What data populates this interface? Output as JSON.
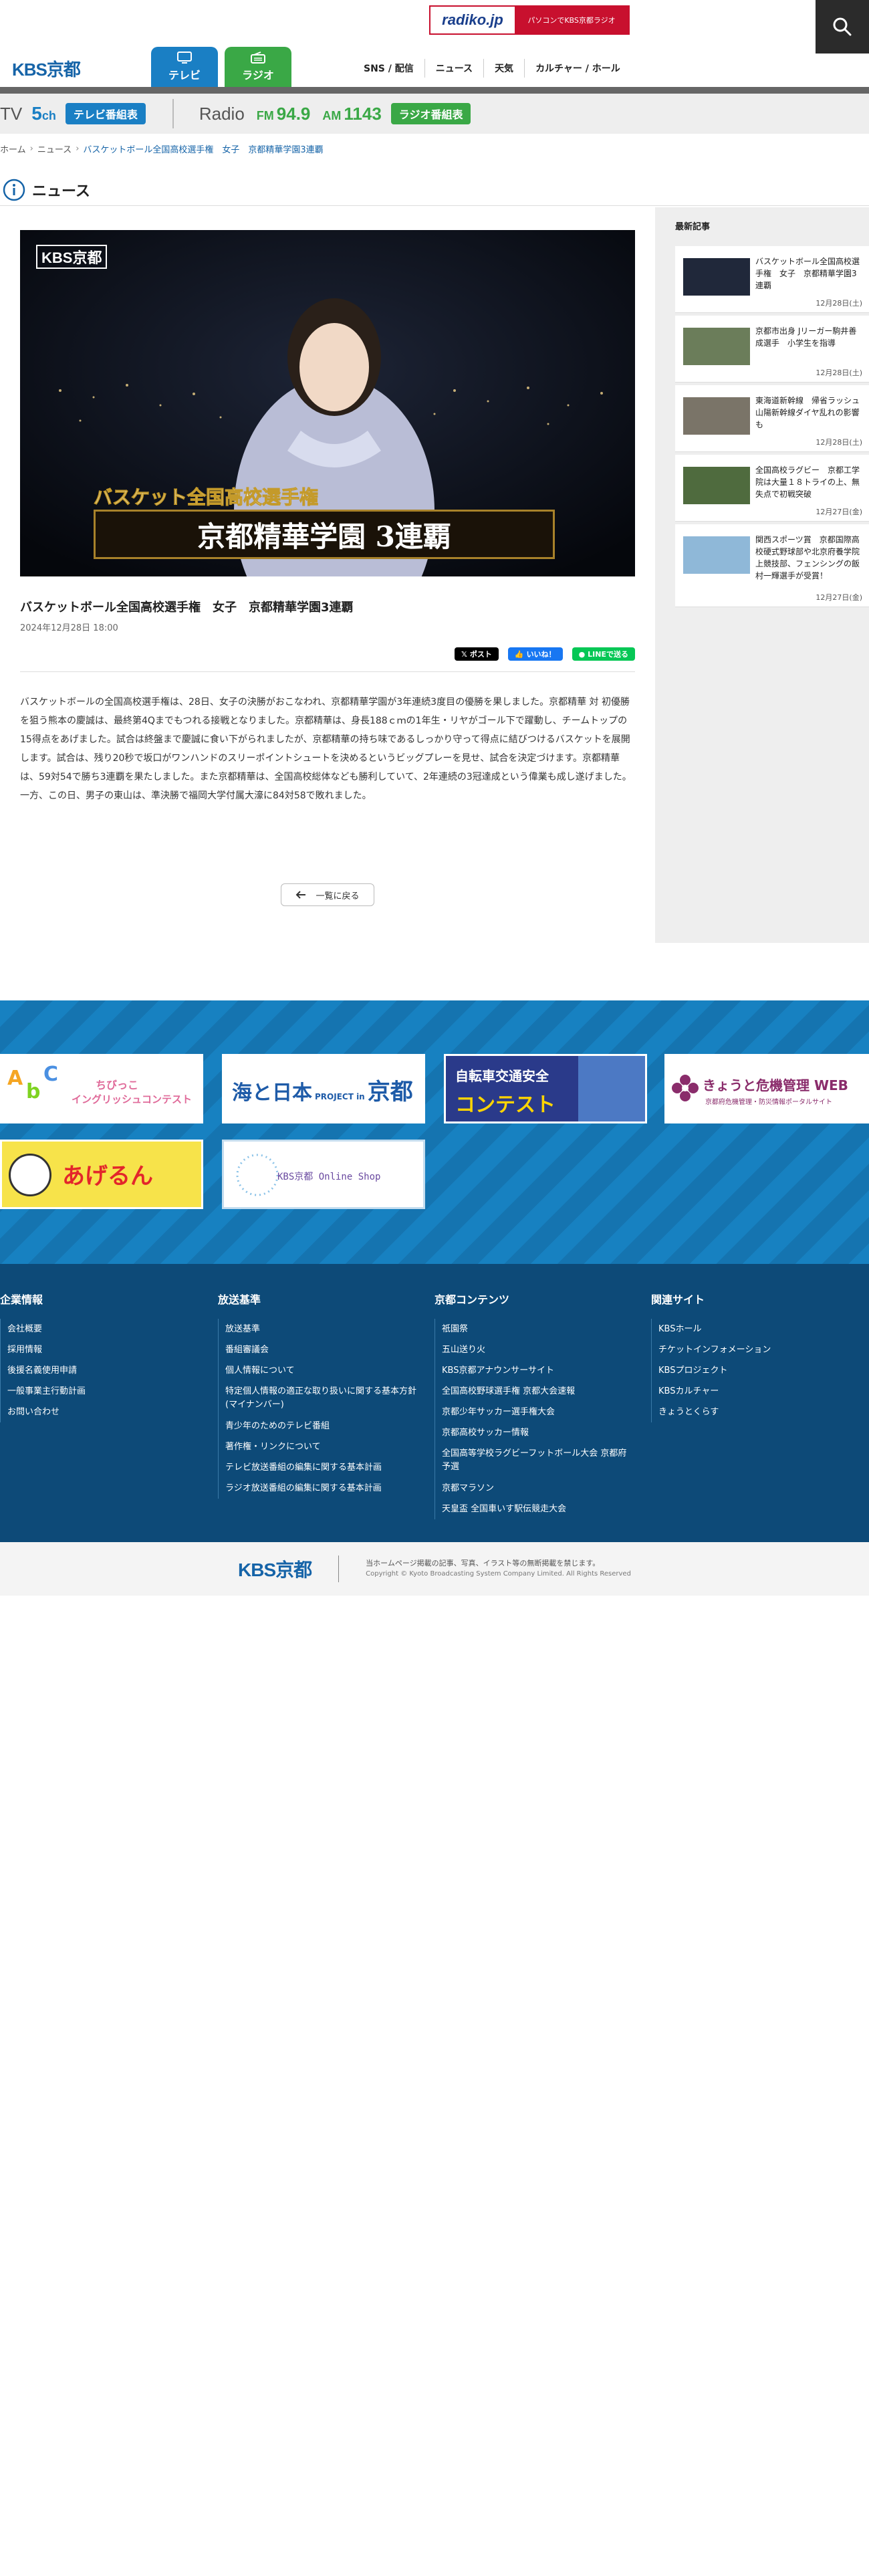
{
  "header": {
    "radiko_logo": "radiko.jp",
    "radiko_text": "パソコンでKBS京都ラジオ",
    "site_logo": "KBS京都",
    "tabs": [
      {
        "label": "テレビ"
      },
      {
        "label": "ラジオ"
      }
    ],
    "nav": [
      "SNS / 配信",
      "ニュース",
      "天気",
      "カルチャー / ホール"
    ]
  },
  "channel_strip": {
    "tv_label": "TV",
    "tv_channel_num": "5",
    "tv_channel_unit": "ch",
    "tv_guide": "テレビ番組表",
    "radio_label": "Radio",
    "fm_label": "FM",
    "fm_value": "94.9",
    "am_label": "AM",
    "am_value": "1143",
    "radio_guide": "ラジオ番組表"
  },
  "breadcrumb": {
    "home": "ホーム",
    "news": "ニュース",
    "current": "バスケットボール全国高校選手権　女子　京都精華学園3連覇"
  },
  "page_title": "ニュース",
  "article": {
    "image": {
      "watermark": "KBS京都",
      "caption_top": "バスケット全国高校選手権",
      "caption_main": "京都精華学園 3連覇"
    },
    "title": "バスケットボール全国高校選手権　女子　京都精華学園3連覇",
    "date": "2024年12月28日 18:00",
    "share": {
      "x": "ポスト",
      "fb": "いいね！",
      "line": "LINEで送る"
    },
    "body": "バスケットボールの全国高校選手権は、28日、女子の決勝がおこなわれ、京都精華学園が3年連続3度目の優勝を果しました。京都精華 対 初優勝を狙う熊本の慶誠は、最終第4Qまでもつれる接戦となりました。京都精華は、身長188ｃｍの1年生・リヤがゴール下で躍動し、チームトップの15得点をあげました。試合は終盤まで慶誠に食い下がられましたが、京都精華の持ち味であるしっかり守って得点に結びつけるバスケットを展開します。試合は、残り20秒で坂口がワンハンドのスリーポイントシュートを決めるというビッグプレーを見せ、試合を決定づけます。京都精華は、59対54で勝ち3連覇を果たしました。また京都精華は、全国高校総体なども勝利していて、2年連続の3冠達成という偉業も成し遂げました。一方、この日、男子の東山は、準決勝で福岡大学付属大濠に84対58で敗れました。",
    "back_label": "一覧に戻る"
  },
  "sidebar": {
    "heading": "最新記事",
    "items": [
      {
        "text": "バスケットボール全国高校選手権　女子　京都精華学園3連覇",
        "date": "12月28日(土)"
      },
      {
        "text": "京都市出身 Jリーガー駒井善成選手　小学生を指導",
        "date": "12月28日(土)"
      },
      {
        "text": "東海道新幹線　帰省ラッシュ　山陽新幹線ダイヤ乱れの影響も",
        "date": "12月28日(土)"
      },
      {
        "text": "全国高校ラグビー　京都工学院は大量１８トライの上、無失点で初戦突破",
        "date": "12月27日(金)"
      },
      {
        "text": "関西スポーツ賞　京都国際高校硬式野球部や北京府養学院上競技部、フェンシングの飯村一輝選手が受賞！",
        "date": "12月27日(金)"
      }
    ]
  },
  "banners": {
    "b1_line1": "ちびっこ",
    "b1_line2": "イングリッシュコンテスト",
    "b2_pre": "海と日本",
    "b2_mid": "PROJECT in",
    "b2_post": "京都",
    "b3_line1": "自転車交通安全",
    "b3_line2": "コンテスト",
    "b4_line1": "きょうと危機管理 WEB",
    "b4_line2": "京都府危機管理・防災情報ポータルサイト",
    "b5_line1": "あげるん",
    "b6_line1": "KBS京都 Online Shop"
  },
  "footer": {
    "cols": [
      {
        "title": "企業情報",
        "items": [
          "会社概要",
          "採用情報",
          "後援名義使用申請",
          "一般事業主行動計画",
          "お問い合わせ"
        ]
      },
      {
        "title": "放送基準",
        "items": [
          "放送基準",
          "番組審議会",
          "個人情報について",
          "特定個人情報の適正な取り扱いに関する基本方針(マイナンバー)",
          "青少年のためのテレビ番組",
          "著作権・リンクについて",
          "テレビ放送番組の編集に関する基本計画",
          "ラジオ放送番組の編集に関する基本計画"
        ]
      },
      {
        "title": "京都コンテンツ",
        "items": [
          "祇園祭",
          "五山送り火",
          "KBS京都アナウンサーサイト",
          "全国高校野球選手権 京都大会速報",
          "京都少年サッカー選手権大会",
          "京都高校サッカー情報",
          "全国高等学校ラグビーフットボール大会 京都府予選",
          "京都マラソン",
          "天皇盃 全国車いす駅伝競走大会"
        ]
      },
      {
        "title": "関連サイト",
        "items": [
          "KBSホール",
          "チケットインフォメーション",
          "KBSプロジェクト",
          "KBSカルチャー",
          "きょうとくらす"
        ]
      }
    ]
  },
  "bottom": {
    "logo": "KBS京都",
    "notice": "当ホームページ掲載の記事、写真、イラスト等の無断掲載を禁じます。",
    "copyright": "Copyright © Kyoto Broadcasting System Company Limited. All Rights Reserved"
  }
}
